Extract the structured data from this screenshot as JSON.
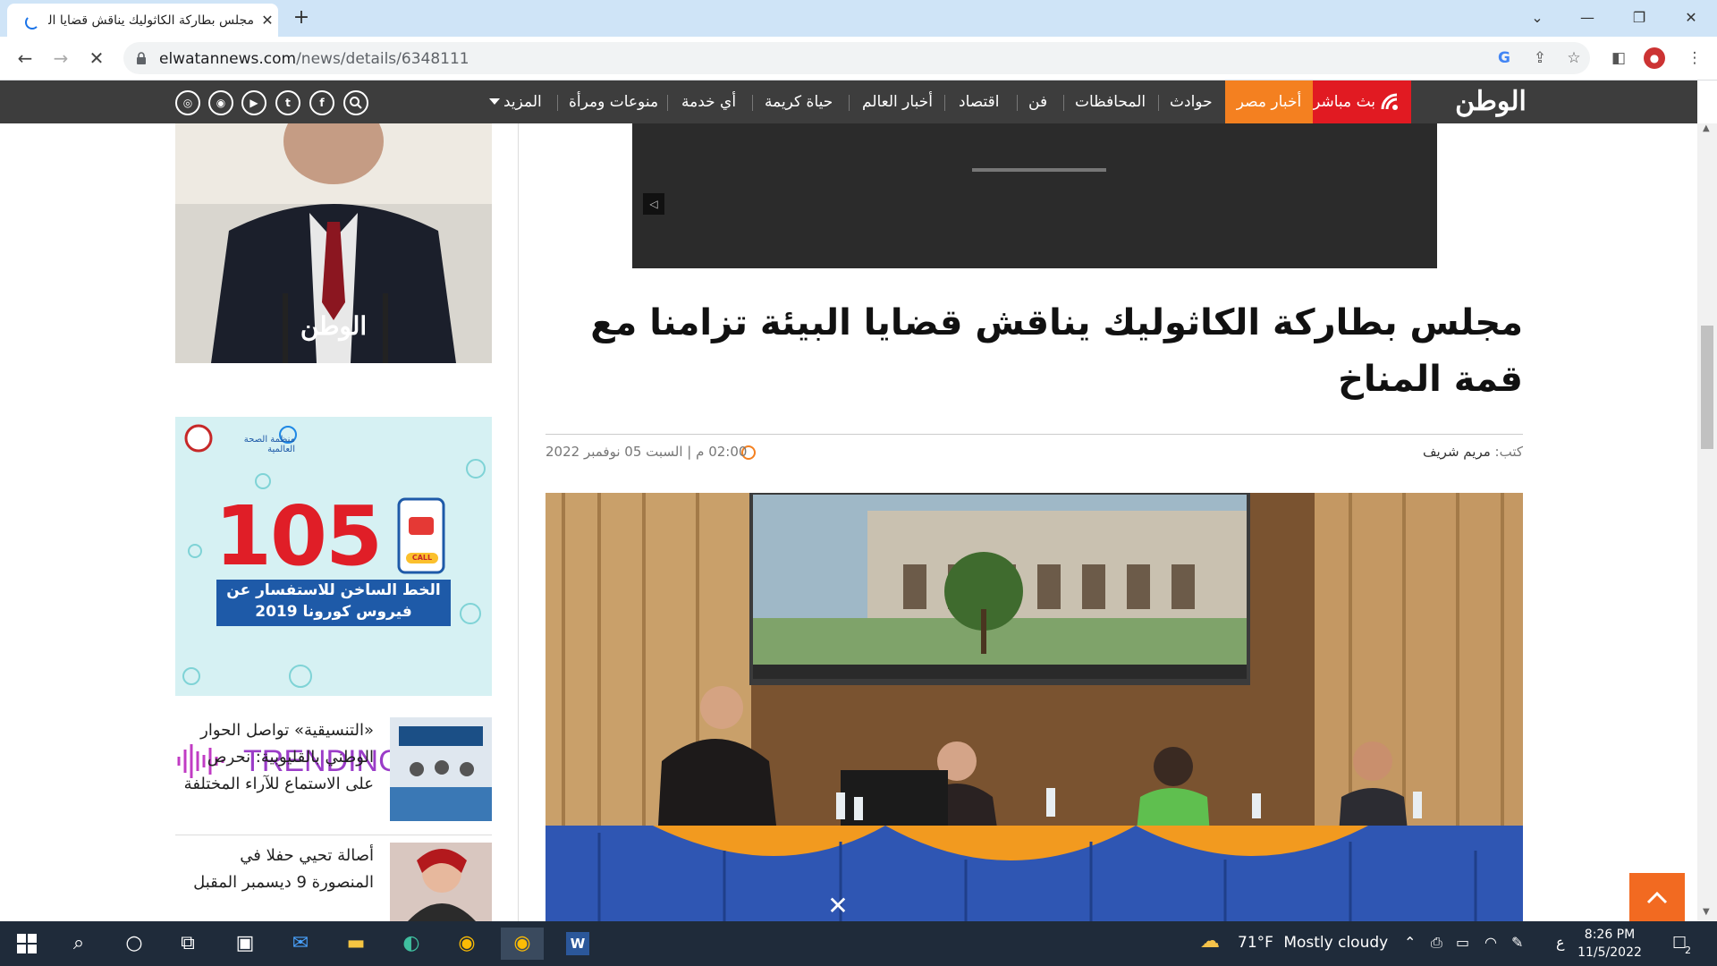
{
  "browser": {
    "tab_title": "مجلس بطاركة الكاثوليك يناقش قضايا البيئة تزامنا مع قمة المناخ",
    "url_domain": "elwatannews.com",
    "url_path": "/news/details/6348111"
  },
  "site": {
    "logo": "الوطن",
    "live_label": "بث مباشر",
    "nav_items": [
      "أخبار مصر",
      "حوادث",
      "المحافظات",
      "فن",
      "اقتصاد",
      "أخبار العالم",
      "حياة كريمة",
      "أي خدمة",
      "منوعات ومرأة",
      "المزيد"
    ],
    "social_icons": [
      "search-icon",
      "facebook-icon",
      "twitter-icon",
      "youtube-icon",
      "rss-icon",
      "instagram-icon"
    ]
  },
  "sidebar": {
    "photo_logo": "الوطن",
    "ad": {
      "number": "105",
      "call": "CALL",
      "line1": "الخط الساخن للاستفسار عن",
      "line2": "فيروس كورونا 2019",
      "org": "منظمة الصحة العالمية"
    },
    "trending_label": "TRENDING",
    "trending": [
      {
        "title": "«التنسيقية» تواصل الحوار الوطني بالقليوبية: نحرص على الاستماع للآراء المختلفة"
      },
      {
        "title": "أصالة تحيي حفلا في المنصورة 9 ديسمبر المقبل"
      }
    ]
  },
  "article": {
    "title": "مجلس بطاركة الكاثوليك يناقش قضايا البيئة تزامنا مع قمة المناخ",
    "byline_label": "كتب:",
    "author": "مريم شريف",
    "date": "02:00 م | السبت 05 نوفمبر 2022"
  },
  "taskbar": {
    "weather_temp": "71°F",
    "weather_desc": "Mostly cloudy",
    "lang": "ع",
    "time": "8:26 PM",
    "date": "11/5/2022",
    "notif_count": "2"
  },
  "colors": {
    "brand_red": "#e11a22",
    "brand_orange": "#f48020",
    "nav_bg": "#3d3d3d"
  }
}
